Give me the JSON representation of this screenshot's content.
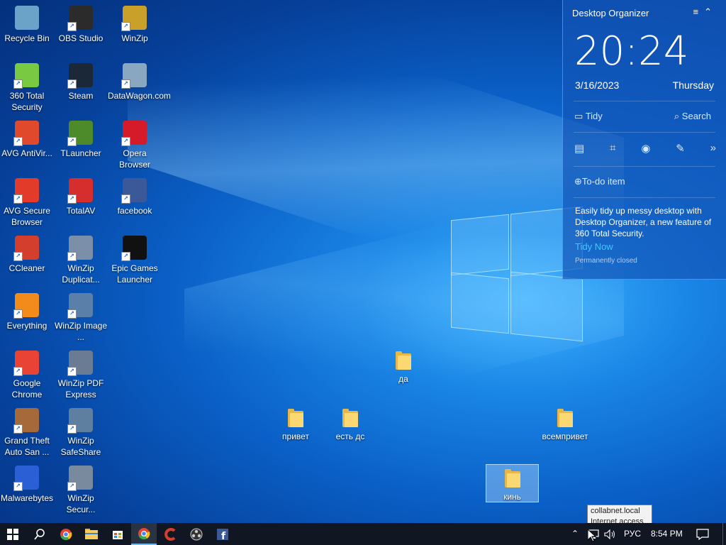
{
  "desktop": {
    "icons": [
      {
        "label": "Recycle Bin",
        "icon": "recycle-bin-icon",
        "color": "#6aa2c8"
      },
      {
        "label": "OBS Studio",
        "icon": "obs-icon",
        "color": "#2b2b2b"
      },
      {
        "label": "WinZip",
        "icon": "winzip-icon",
        "color": "#c9a12a"
      },
      {
        "label": "360 Total Security",
        "icon": "360-security-icon",
        "color": "#7ac943"
      },
      {
        "label": "Steam",
        "icon": "steam-icon",
        "color": "#1b2838"
      },
      {
        "label": "DataWagon.com",
        "icon": "datawagon-icon",
        "color": "#8aa7c2"
      },
      {
        "label": "AVG AntiVir...",
        "icon": "avg-icon",
        "color": "#e0492b"
      },
      {
        "label": "TLauncher",
        "icon": "tlauncher-icon",
        "color": "#4c8a2a"
      },
      {
        "label": "Opera Browser",
        "icon": "opera-icon",
        "color": "#d51b29"
      },
      {
        "label": "AVG Secure Browser",
        "icon": "avg-browser-icon",
        "color": "#e33b2a"
      },
      {
        "label": "TotalAV",
        "icon": "totalav-icon",
        "color": "#d62d2d"
      },
      {
        "label": "facebook",
        "icon": "facebook-icon",
        "color": "#3b5998"
      },
      {
        "label": "CCleaner",
        "icon": "ccleaner-icon",
        "color": "#d33f2c"
      },
      {
        "label": "WinZip Duplicat...",
        "icon": "winzip-duplicate-icon",
        "color": "#7c8fa8"
      },
      {
        "label": "Epic Games Launcher",
        "icon": "epic-games-icon",
        "color": "#111111"
      },
      {
        "label": "Everything",
        "icon": "everything-icon",
        "color": "#f28b1a"
      },
      {
        "label": "WinZip Image ...",
        "icon": "winzip-image-icon",
        "color": "#5a7fa8"
      },
      {
        "label": "Google Chrome",
        "icon": "chrome-icon",
        "color": "#e84335"
      },
      {
        "label": "WinZip PDF Express",
        "icon": "winzip-pdf-icon",
        "color": "#6a7c94"
      },
      {
        "label": "Grand Theft Auto San ...",
        "icon": "gta-icon",
        "color": "#a5693a"
      },
      {
        "label": "WinZip SafeShare",
        "icon": "winzip-safeshare-icon",
        "color": "#5f7fa0"
      },
      {
        "label": "Malwarebytes",
        "icon": "malwarebytes-icon",
        "color": "#2a5fd6"
      },
      {
        "label": "WinZip Secur...",
        "icon": "winzip-secure-icon",
        "color": "#7a8a9e"
      }
    ],
    "folders": [
      {
        "label": "да"
      },
      {
        "label": "привет"
      },
      {
        "label": "есть дс"
      },
      {
        "label": "всемпривет"
      },
      {
        "label": "кинь"
      }
    ]
  },
  "organizer": {
    "title": "Desktop Organizer",
    "menu_icon": "≡",
    "collapse_icon": "⌃",
    "time": "20:24",
    "date": "3/16/2023",
    "weekday": "Thursday",
    "tidy_label": "Tidy",
    "search_label": "Search",
    "todo_label": "To-do item",
    "message": "Easily tidy up messy desktop with Desktop Organizer, a new feature of 360 Total Security.",
    "tidy_now": "Tidy Now",
    "permanently_closed": "Permanently closed"
  },
  "taskbar": {
    "tray_language": "РУС",
    "clock": "8:54 PM"
  },
  "tooltip": {
    "line1": "collabnet.local",
    "line2": "Internet access"
  }
}
